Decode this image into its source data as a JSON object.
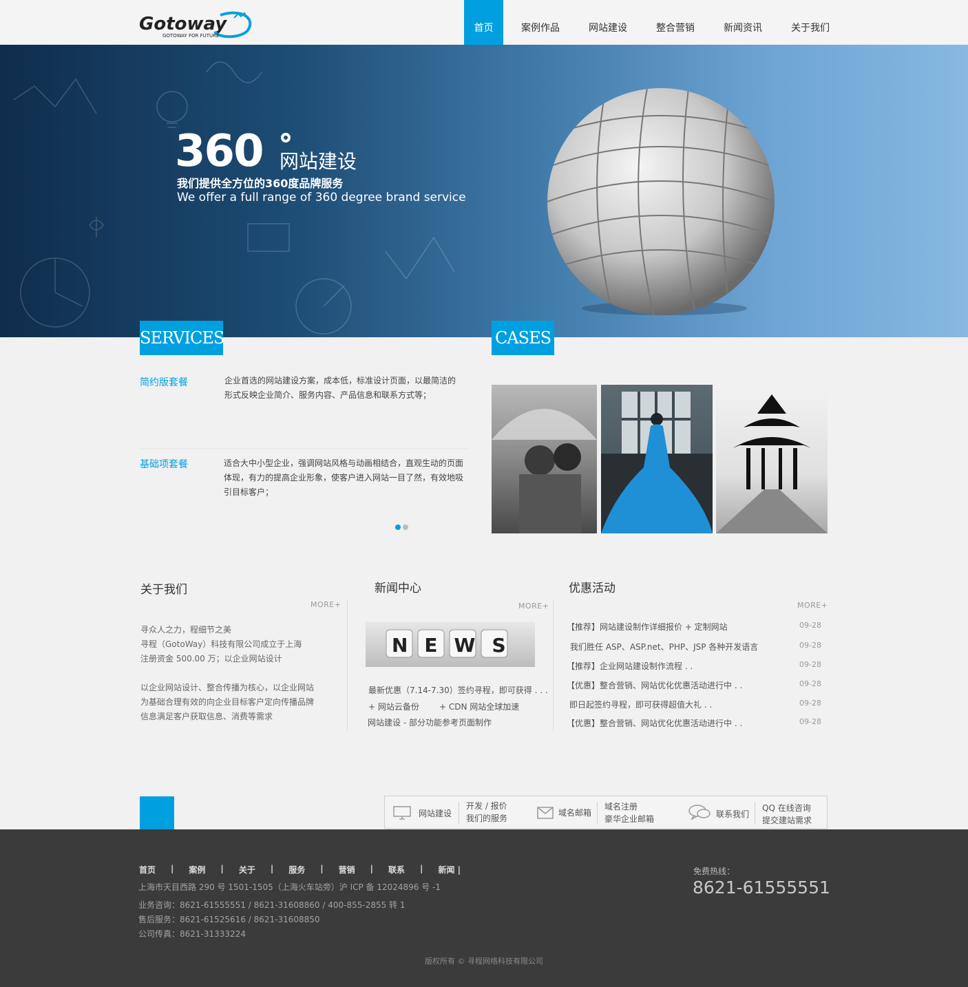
{
  "header": {
    "logo_text": "Gotoway",
    "logo_tagline": "GOTOWAY FOR FUTURE",
    "nav": [
      "首页",
      "案例作品",
      "网站建设",
      "整合营销",
      "新闻资讯",
      "关于我们"
    ]
  },
  "banner": {
    "big_number": "360",
    "title": "网站建设",
    "subtitle_cn": "我们提供全方位的360度品牌服务",
    "subtitle_en": "We offer a full range of 360 degree brand service"
  },
  "services": {
    "tag": "SERVICES",
    "items": [
      {
        "name": "简约版套餐",
        "desc_lines": [
          "企业首选的网站建设方案，成本低，标准设计页面，以最简洁的",
          "形式反映企业简介、服务内容、产品信息和联系方式等；"
        ]
      },
      {
        "name": "基础项套餐",
        "desc_lines": [
          "适合大中小型企业，强调网站风格与动画相结合，直观生动的页面",
          "体现，有力的提高企业形象，使客户进入网站一目了然，有效地吸",
          "引目标客户；"
        ]
      }
    ]
  },
  "cases": {
    "tag": "CASES"
  },
  "about": {
    "title": "关于我们",
    "more": "MORE+",
    "lines": [
      "寻众人之力，程细节之美",
      "寻程（GotoWay）科技有限公司成立于上海",
      "注册资金 500.00 万；以企业网站设计",
      "",
      "以企业网站设计、整合传播为核心，以企业网站",
      "为基础合理有效的向企业目标客户定向传播品牌",
      "信息满足客户获取信息、消费等需求"
    ]
  },
  "news": {
    "title": "新闻中心",
    "more": "MORE+",
    "image_word": "NEWS",
    "lines": [
      "最新优惠（7.14-7.30）签约寻程，即可获得 . . .",
      "+ 网站云备份",
      "+ CDN 网站全球加速",
      "网站建设 - 部分功能参考页面制作"
    ]
  },
  "promo": {
    "title": "优惠活动",
    "more": "MORE+",
    "rows": [
      {
        "text": "【推荐】网站建设制作详细报价     + 定制网站",
        "date": "09-28"
      },
      {
        "text": "我们胜任 ASP、ASP.net、PHP、JSP 各种开发语言",
        "date": "09-28"
      },
      {
        "text": "【推荐】企业网站建设制作流程 . .",
        "date": "09-28"
      },
      {
        "text": "【优惠】整合营销、网站优化优惠活动进行中 . .",
        "date": "09-28"
      },
      {
        "text": "即日起签约寻程，即可获得超值大礼 . .",
        "date": "09-28"
      },
      {
        "text": "【优惠】整合营销、网站优化优惠活动进行中 . .",
        "date": "09-28"
      }
    ]
  },
  "quick": {
    "web_build": "网站建设",
    "web_build_sub1": "开发 / 报价",
    "web_build_sub2": "我们的服务",
    "mail": "域名邮箱",
    "mail_sub1": "域名注册",
    "mail_sub2": "豪华企业邮箱",
    "contact": "联系我们",
    "contact_sub1": "QQ 在线咨询",
    "contact_sub2": "提交建站需求"
  },
  "footer": {
    "nav": [
      "首页",
      "案例",
      "关于",
      "服务",
      "营销",
      "联系",
      "新闻 |"
    ],
    "address": "上海市天目西路 290 号 1501-1505（上海火车站旁）沪 ICP 备 12024896 号 -1",
    "consult": "业务咨询：8621-61555551 / 8621-31608860 / 400-855-2855 转 1",
    "after_sale": "售后服务：8621-61525616 / 8621-31608850",
    "fax": "公司传真：8621-31333224",
    "hotline_label": "免费热线：",
    "hotline": "8621-61555551",
    "copyright": "版权所有 © 寻程网络科技有限公司"
  }
}
